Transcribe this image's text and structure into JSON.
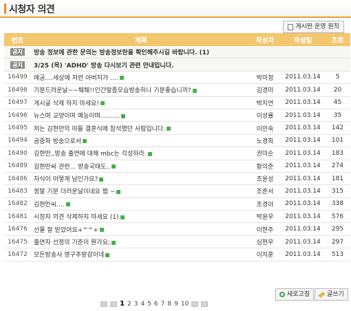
{
  "page": {
    "title": "시청자 의견"
  },
  "toolbar": {
    "rules_label": "게시판 운영 원칙",
    "refresh_label": "새로고침",
    "write_label": "글쓰기"
  },
  "table": {
    "headers": {
      "no": "번호",
      "subject": "제목",
      "author": "작성자",
      "date": "작성일",
      "views": "조회"
    },
    "notices": [
      {
        "badge": "공지",
        "subject": "방송 정보에 관한 문의는 방송정보란을 확인해주시길 바랍니다. (1)"
      },
      {
        "badge": "공지",
        "subject": "3/25 (목) 'ADHD' 방송 다시보기 관련 안내입니다."
      }
    ],
    "rows": [
      {
        "no": "16499",
        "subject": "에궁....세상에 저런 아버지가 ....",
        "author": "박미정",
        "date": "2011.03.14",
        "views": "5"
      },
      {
        "no": "16498",
        "subject": "기분드러운날~~퉤퉤!!인간말종모습방송하니 기분좋습니까?",
        "author": "김경미",
        "date": "2011.03.14",
        "views": "20"
      },
      {
        "no": "16497",
        "subject": "게시글 삭제 하지 마세요!",
        "author": "박지연",
        "date": "2011.03.14",
        "views": "45"
      },
      {
        "no": "16496",
        "subject": "뉴스며 교양이며 예능이며..........",
        "author": "이성률",
        "date": "2011.03.14",
        "views": "35"
      },
      {
        "no": "16495",
        "subject": "저는 김현만의 아들 결혼식에 참석했던 사람입니다.",
        "author": "이민숙",
        "date": "2011.03.14",
        "views": "142"
      },
      {
        "no": "16494",
        "subject": "공중파 방송으로서",
        "author": "노경희",
        "date": "2011.03.14",
        "views": "101"
      },
      {
        "no": "16490",
        "subject": "김현만,,방송 출연에 대해 mbc는 각성하라.",
        "author": "권미순",
        "date": "2011.03.14",
        "views": "183"
      },
      {
        "no": "16489",
        "subject": "김현만씨 관련... 방송국태도..",
        "author": "황의준",
        "date": "2011.03.14",
        "views": "274"
      },
      {
        "no": "16486",
        "subject": "자식이 어떻게 남인가요?",
        "author": "조윤성",
        "date": "2011.03.14",
        "views": "181"
      },
      {
        "no": "16483",
        "subject": "정말 기분 더러운날이네요 쩝 ~",
        "author": "조준서",
        "date": "2011.03.14",
        "views": "315"
      },
      {
        "no": "16482",
        "subject": "김현만씨....",
        "author": "조경아",
        "date": "2011.03.14",
        "views": "338"
      },
      {
        "no": "16481",
        "subject": "시청자 의견 삭제하지 마세요 (1)",
        "author": "박윤우",
        "date": "2011.03.14",
        "views": "576"
      },
      {
        "no": "16476",
        "subject": "선물 잘 받았어요+^^+",
        "author": "이현주",
        "date": "2011.03.14",
        "views": "295"
      },
      {
        "no": "16475",
        "subject": "출연자 선정의 기준이 뭔가요;",
        "author": "심현우",
        "date": "2011.03.14",
        "views": "297"
      },
      {
        "no": "16472",
        "subject": "모든방송사 영구추방감이네",
        "author": "이지훈",
        "date": "2011.03.14",
        "views": "513"
      }
    ]
  },
  "pagination": {
    "current": "1",
    "pages": [
      "1",
      "2",
      "3",
      "4",
      "5",
      "6",
      "7",
      "8",
      "9",
      "10"
    ]
  }
}
